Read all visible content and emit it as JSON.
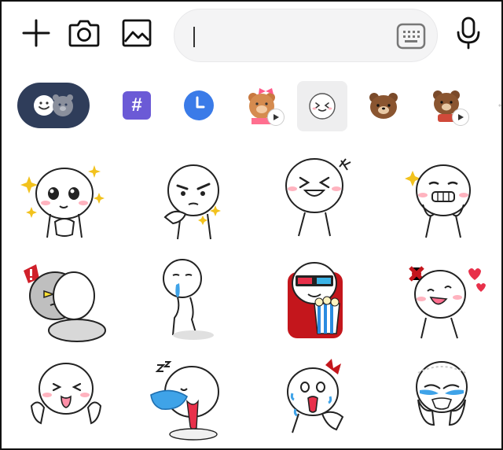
{
  "toolbar": {
    "add_icon": "plus-icon",
    "camera_icon": "camera-icon",
    "gallery_icon": "image-icon",
    "mic_icon": "microphone-icon",
    "keyboard_icon": "keyboard-icon",
    "message_input": {
      "value": "",
      "placeholder": ""
    }
  },
  "tabs": [
    {
      "id": "emoji-moon-brown",
      "icon": "emoji-face-icon",
      "active": true
    },
    {
      "id": "hashtag",
      "icon": "hashtag-icon",
      "glyph": "#"
    },
    {
      "id": "recent",
      "icon": "clock-icon"
    },
    {
      "id": "choco-animated",
      "icon": "choco-bear-sticker-icon",
      "animated": true
    },
    {
      "id": "moon",
      "icon": "moon-sticker-icon",
      "selected": true
    },
    {
      "id": "brown",
      "icon": "brown-bear-sticker-icon"
    },
    {
      "id": "brown-animated",
      "icon": "brown-bear-animated-sticker-icon",
      "animated": true
    },
    {
      "id": "settings",
      "icon": "gear-icon"
    }
  ],
  "stickers": [
    {
      "name": "sticker-starry-eyes"
    },
    {
      "name": "sticker-thinking-eyebrow"
    },
    {
      "name": "sticker-laughing-x-eyes"
    },
    {
      "name": "sticker-grinning-sparkle"
    },
    {
      "name": "sticker-angry-peeking"
    },
    {
      "name": "sticker-drooling-walk"
    },
    {
      "name": "sticker-3d-glasses-popcorn"
    },
    {
      "name": "sticker-love-hearts"
    },
    {
      "name": "sticker-tongue-out"
    },
    {
      "name": "sticker-sleeping-zzz"
    },
    {
      "name": "sticker-crying-shocked"
    },
    {
      "name": "sticker-crying-hands"
    }
  ],
  "colors": {
    "pill_bg": "#2f3d5a",
    "hashtag_bg": "#6b5ad6",
    "clock_bg": "#3a7be8",
    "blush": "#ffb3bf",
    "star": "#f2c21d"
  }
}
